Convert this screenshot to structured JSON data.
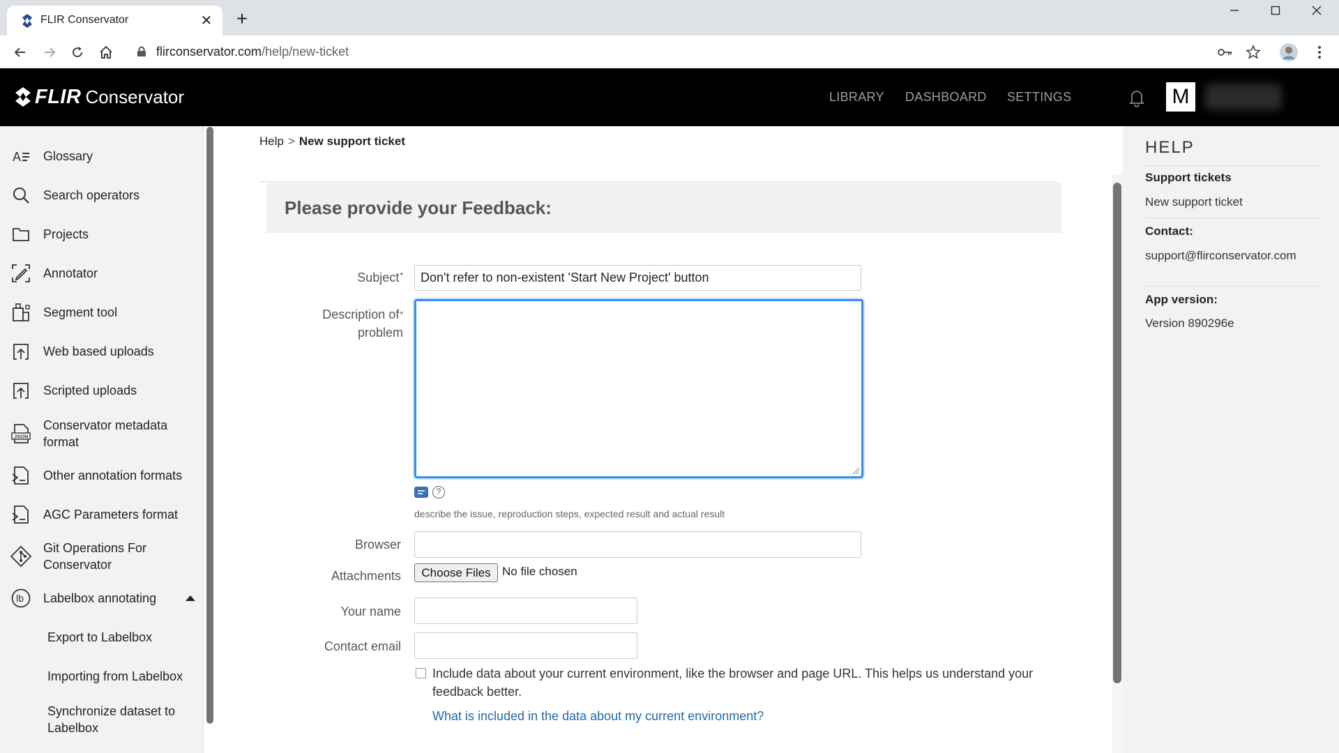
{
  "browser": {
    "tab_title": "FLIR Conservator",
    "url_host": "flirconservator.com",
    "url_path": "/help/new-ticket"
  },
  "header": {
    "logo_flir": "FLIR",
    "logo_conservator": "Conservator",
    "nav": [
      "LIBRARY",
      "DASHBOARD",
      "SETTINGS"
    ],
    "avatar_letter": "M"
  },
  "sidebar": {
    "items": [
      {
        "label": "Glossary",
        "icon": "glossary-icon"
      },
      {
        "label": "Search operators",
        "icon": "search-icon"
      },
      {
        "label": "Projects",
        "icon": "folder-icon"
      },
      {
        "label": "Annotator",
        "icon": "annotator-icon"
      },
      {
        "label": "Segment tool",
        "icon": "segment-icon"
      },
      {
        "label": "Web based uploads",
        "icon": "upload-icon"
      },
      {
        "label": "Scripted uploads",
        "icon": "upload-icon"
      },
      {
        "label": "Conservator metadata format",
        "icon": "json-icon"
      },
      {
        "label": "Other annotation formats",
        "icon": "document-icon"
      },
      {
        "label": "AGC Parameters format",
        "icon": "document-icon"
      },
      {
        "label": "Git Operations For Conservator",
        "icon": "git-icon"
      },
      {
        "label": "Labelbox annotating",
        "icon": "labelbox-icon"
      }
    ],
    "sub_items": [
      "Export to Labelbox",
      "Importing from Labelbox",
      "Synchronize dataset to Labelbox"
    ]
  },
  "main": {
    "breadcrumb": {
      "parent": "Help",
      "separator": ">",
      "current": "New support ticket"
    },
    "feedback_title": "Please provide your Feedback:",
    "form": {
      "subject_label": "Subject",
      "subject_value": "Don't refer to non-existent 'Start New Project' button",
      "description_label": "Description of problem",
      "description_label_line1": "Description of",
      "description_label_line2": "problem",
      "description_value": "",
      "description_hint": "describe the issue, reproduction steps, expected result and actual result",
      "browser_label": "Browser",
      "browser_value": "",
      "attachments_label": "Attachments",
      "choose_files": "Choose Files",
      "no_file": "No file chosen",
      "name_label": "Your name",
      "name_value": "",
      "email_label": "Contact email",
      "email_value": "",
      "env_checkbox_text": "Include data about your current environment, like the browser and page URL. This helps us understand your feedback better.",
      "env_checked": false,
      "env_link": "What is included in the data about my current environment?"
    }
  },
  "help": {
    "title": "HELP",
    "support_tickets": "Support tickets",
    "new_support_ticket": "New support ticket",
    "contact_label": "Contact:",
    "contact_email": "support@flirconservator.com",
    "version_label": "App version:",
    "version_value": "Version 890296e"
  },
  "colors": {
    "accent": "#3b8eea",
    "link": "#1e6ab0",
    "header_bg": "#000000",
    "sidebar_bg": "#f2f2f2"
  }
}
